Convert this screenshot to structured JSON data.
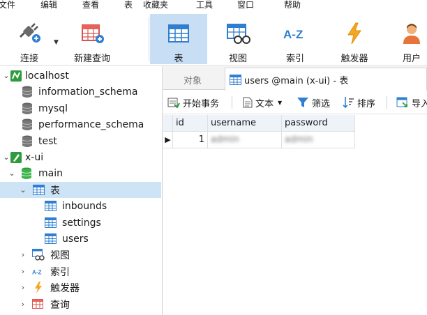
{
  "menu": {
    "file": "文件",
    "edit": "编辑",
    "view": "查看",
    "table": "表",
    "favorites": "收藏夹",
    "tools": "工具",
    "window": "窗口",
    "help": "帮助"
  },
  "toolbar": {
    "connect": "连接",
    "new_query": "新建查询",
    "table": "表",
    "view": "视图",
    "index": "索引",
    "trigger": "触发器",
    "user": "用户"
  },
  "tree": {
    "localhost": "localhost",
    "information_schema": "information_schema",
    "mysql": "mysql",
    "performance_schema": "performance_schema",
    "test": "test",
    "xui": "x-ui",
    "main": "main",
    "tables_group": "表",
    "inbounds": "inbounds",
    "settings": "settings",
    "users": "users",
    "views_group": "视图",
    "indexes_group": "索引",
    "triggers_group": "触发器",
    "queries_group": "查询"
  },
  "tabs": {
    "objects": "对象",
    "users_tab": "users @main (x-ui) - 表"
  },
  "subtoolbar": {
    "begin_transaction": "开始事务",
    "text": "文本",
    "filter": "筛选",
    "sort": "排序",
    "import": "导入"
  },
  "grid": {
    "columns": [
      "id",
      "username",
      "password"
    ],
    "rows": [
      {
        "id": "1",
        "username": "admin",
        "password": "admin"
      }
    ]
  },
  "colors": {
    "selection": "#cde3f6",
    "active_tool": "#c7def4",
    "table_icon_blue": "#2f7fd0",
    "db_green": "#2e9c3c",
    "trigger_orange": "#f5a623"
  }
}
